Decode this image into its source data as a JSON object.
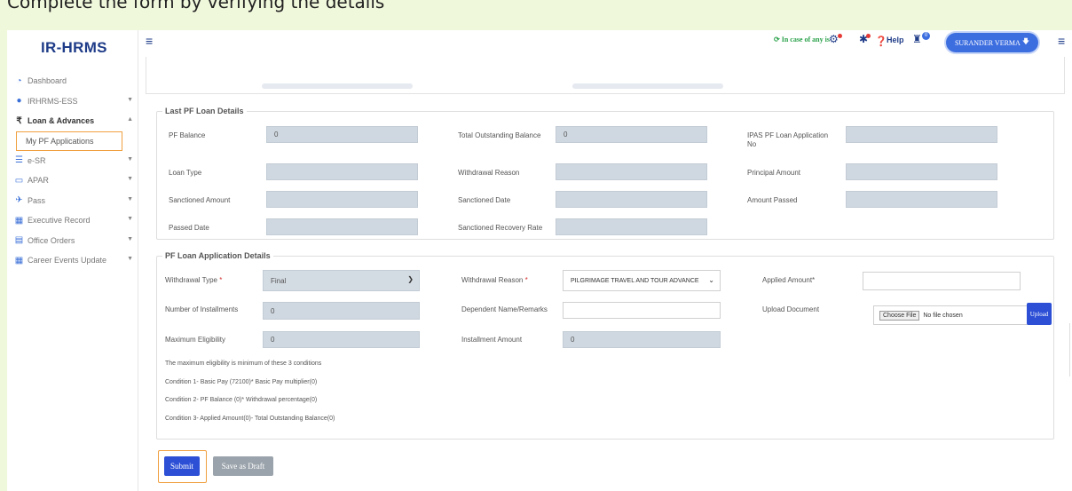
{
  "banner": {
    "text": "Complete the form by verifying the details"
  },
  "app": {
    "title": "IR-HRMS"
  },
  "sidebar": {
    "items": [
      {
        "label": "Dashboard",
        "icon": "dashboard-icon",
        "caret": false
      },
      {
        "label": "IRHRMS-ESS",
        "icon": "user-icon",
        "caret": true
      },
      {
        "label": "Loan & Advances",
        "icon": "rupee-icon",
        "caret": true
      },
      {
        "label": "e-SR",
        "icon": "database-icon",
        "caret": true
      },
      {
        "label": "APAR",
        "icon": "card-icon",
        "caret": true
      },
      {
        "label": "Pass",
        "icon": "plane-icon",
        "caret": true
      },
      {
        "label": "Executive Record",
        "icon": "table-icon",
        "caret": true
      },
      {
        "label": "Office Orders",
        "icon": "file-icon",
        "caret": true
      },
      {
        "label": "Career Events Update",
        "icon": "table-icon",
        "caret": true
      }
    ],
    "sub_item": "My PF Applications"
  },
  "topbar": {
    "helpline": "In case of any is",
    "help": "Help",
    "notif_count": "0",
    "user": "SURANDER VERMA"
  },
  "last_pf": {
    "legend": "Last PF Loan Details",
    "pf_balance_label": "PF Balance",
    "pf_balance": "0",
    "outstanding_label": "Total Outstanding Balance",
    "outstanding": "0",
    "ipas_label": "IPAS PF Loan Application No",
    "loan_type_label": "Loan Type",
    "withdrawal_reason_label": "Withdrawal Reason",
    "principal_label": "Principal Amount",
    "sanctioned_amount_label": "Sanctioned Amount",
    "sanctioned_date_label": "Sanctioned Date",
    "amount_passed_label": "Amount Passed",
    "passed_date_label": "Passed Date",
    "recovery_rate_label": "Sanctioned Recovery Rate"
  },
  "application": {
    "legend": "PF Loan Application Details",
    "withdrawal_type_label": "Withdrawal Type",
    "withdrawal_type": "Final",
    "withdrawal_reason_label": "Withdrawal Reason",
    "withdrawal_reason": "PILGRIMAGE TRAVEL AND TOUR ADVANCE",
    "applied_amount_label": "Applied Amount*",
    "applied_amount": "",
    "installments_label": "Number of Installments",
    "installments": "0",
    "dependent_label": "Dependent Name/Remarks",
    "dependent": "",
    "upload_label": "Upload Document",
    "choose_file": "Choose File",
    "no_file": "No file chosen",
    "upload_btn": "Upload",
    "max_elig_label": "Maximum Eligibility",
    "max_elig": "0",
    "installment_amount_label": "Installment Amount",
    "installment_amount": "0",
    "notes": [
      "The maximum eligibility is minimum of these 3 conditions",
      "Condition 1- Basic Pay (72100)* Basic Pay multiplier(0)",
      "Condition 2- PF Balance (0)* Withdrawal percentage(0)",
      "Condition 3- Applied Amount(0)- Total Outstanding Balance(0)"
    ]
  },
  "actions": {
    "submit": "Submit",
    "draft": "Save as Draft"
  },
  "colors": {
    "brand": "#1f3c88",
    "primary": "#2c4fd6",
    "highlight": "#f0a040"
  }
}
